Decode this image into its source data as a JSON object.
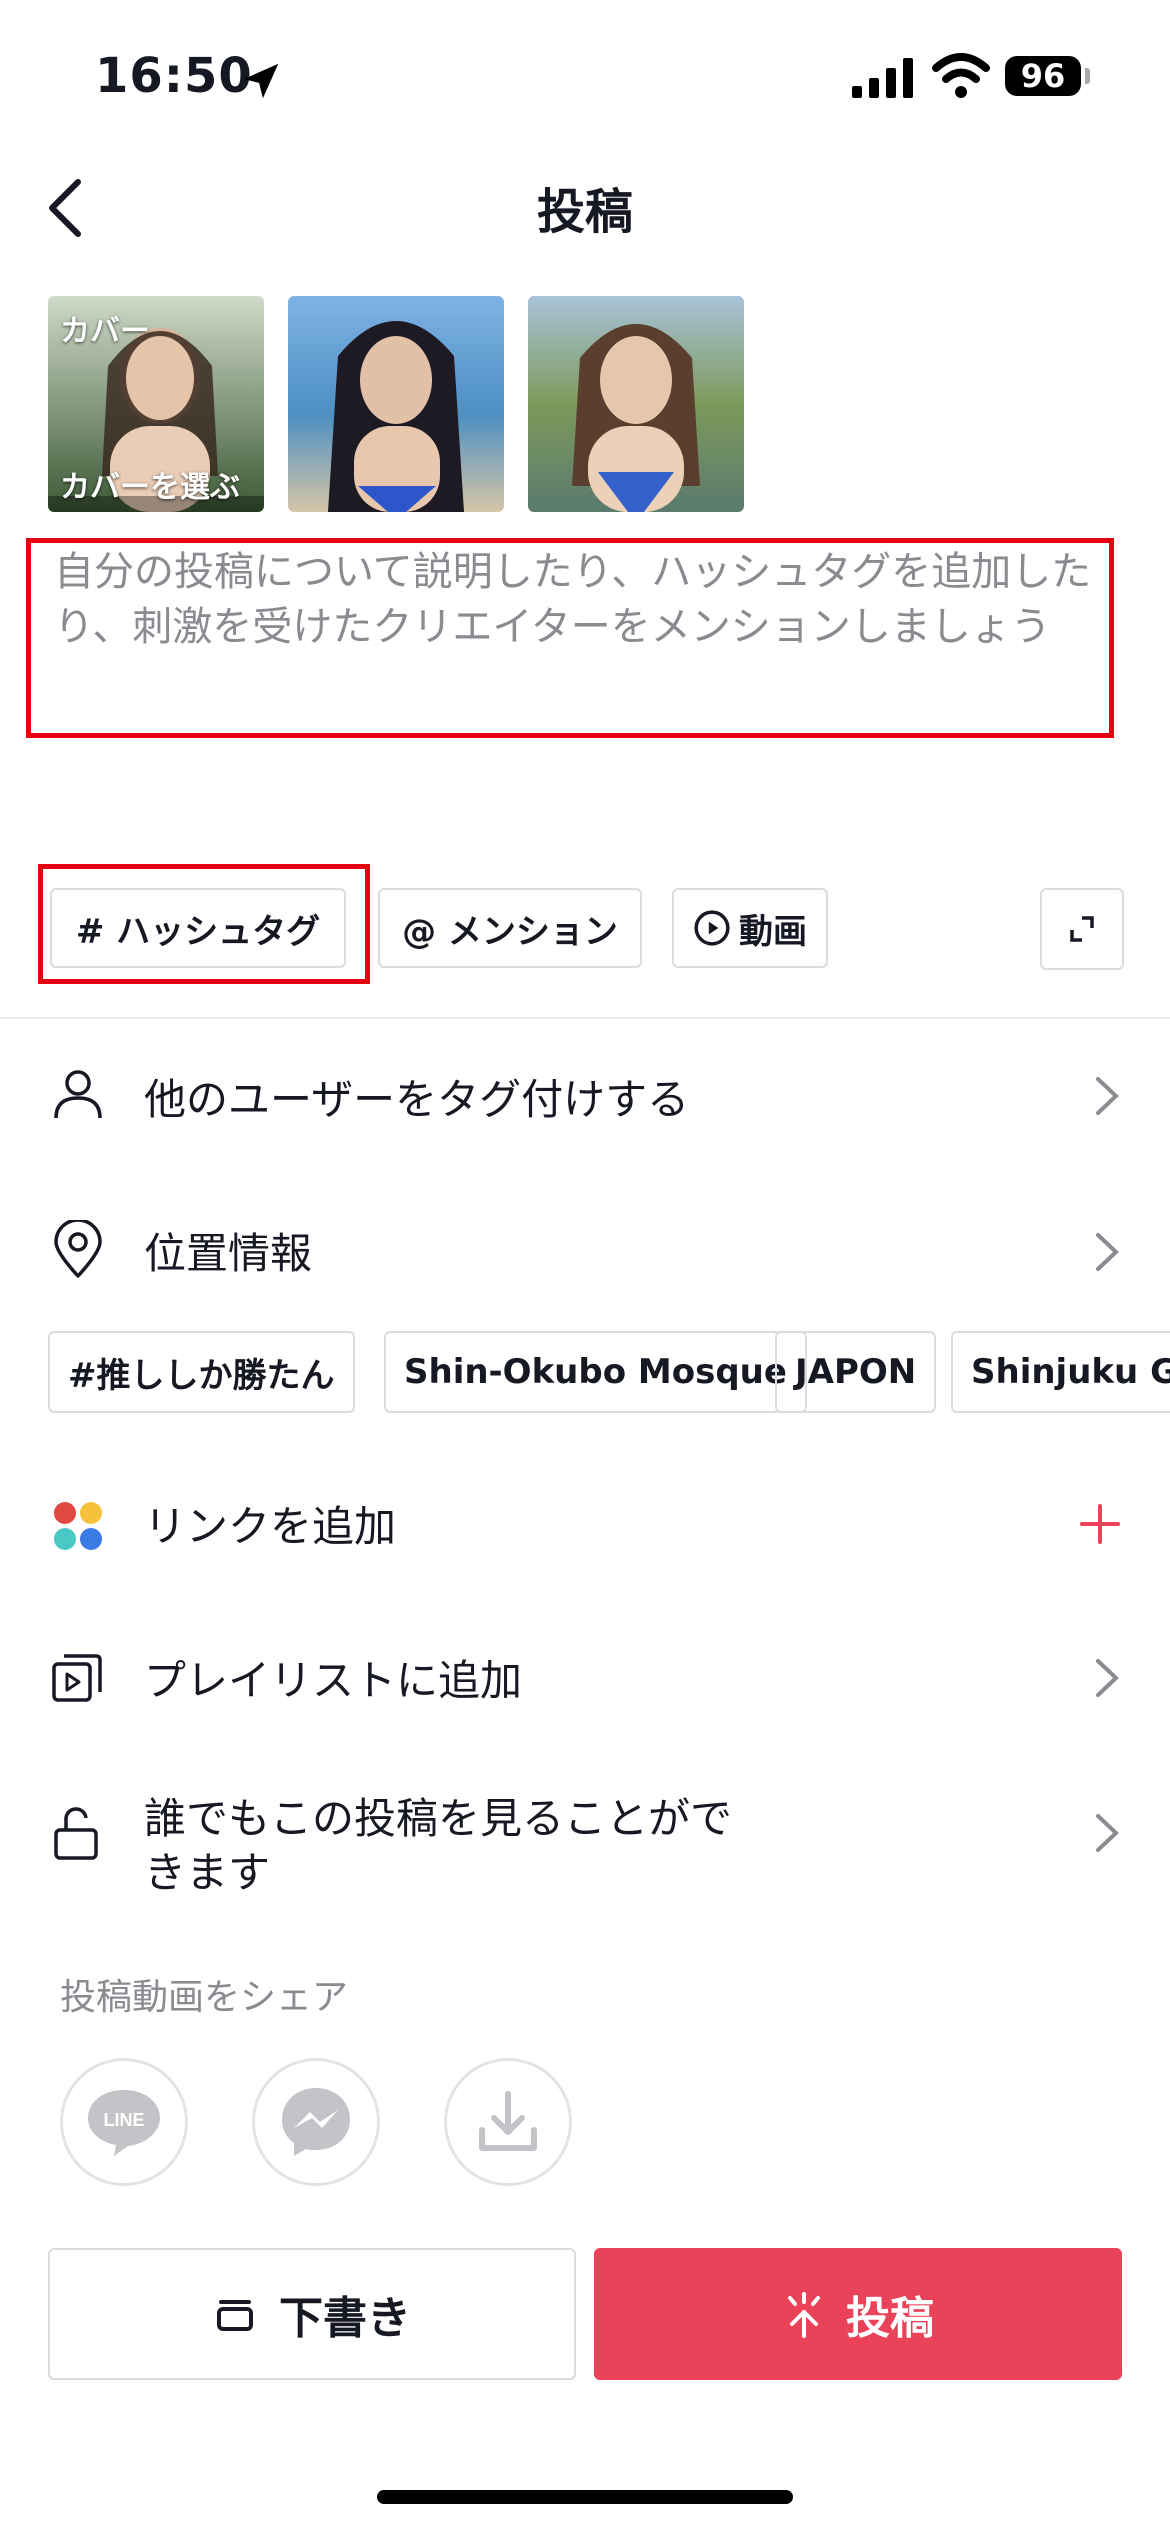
{
  "status_bar": {
    "time": "16:50",
    "battery": "96"
  },
  "header": {
    "title": "投稿"
  },
  "thumbnails": [
    {
      "top_label": "カバー",
      "bottom_label": "カバーを選ぶ",
      "colors": [
        "#cfd9c8",
        "#3c5a35"
      ]
    },
    {
      "colors": [
        "#7fb3e6",
        "#d6c6a8"
      ]
    },
    {
      "colors": [
        "#a8c2d8",
        "#7d9a5c"
      ]
    }
  ],
  "caption": {
    "placeholder": "自分の投稿について説明したり、ハッシュタグを追加したり、刺激を受けたクリエイターをメンションしましょう"
  },
  "chips": {
    "hashtag": "# ハッシュタグ",
    "mention": "@ メンション",
    "video": "動画"
  },
  "rows": {
    "tag_users": "他のユーザーをタグ付けする",
    "location": "位置情報",
    "add_link": "リンクを追加",
    "playlist": "プレイリストに追加",
    "privacy_line1": "誰でもこの投稿を見ることがで",
    "privacy_line2": "きます"
  },
  "location_suggestions": [
    "#推ししか勝たん",
    "Shin-Okubo Mosque",
    "JAPON",
    "Shinjuku Gyo"
  ],
  "share": {
    "label": "投稿動画をシェア",
    "line_text": "LINE"
  },
  "buttons": {
    "draft": "下書き",
    "post": "投稿"
  },
  "colors": {
    "accent": "#ea4359",
    "highlight": "#e60012"
  }
}
